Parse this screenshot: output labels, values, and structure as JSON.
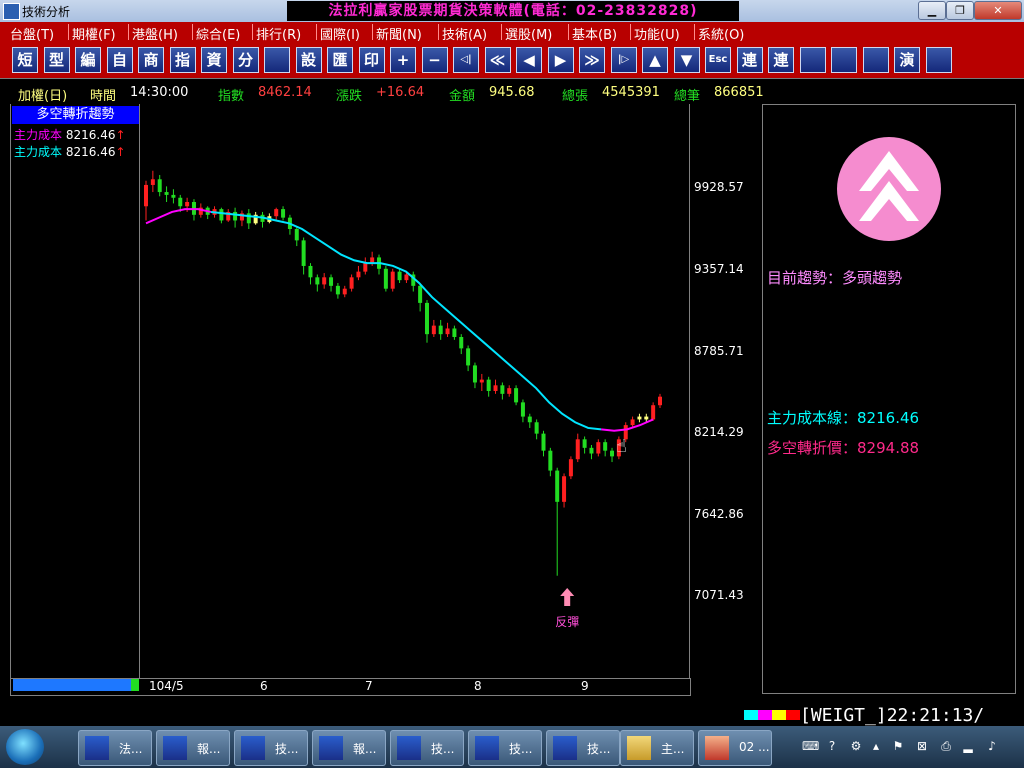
{
  "window": {
    "title": "技術分析",
    "banner": "法拉利贏家股票期貨決策軟體(電話：02-23832828)"
  },
  "menu": [
    {
      "label": "台盤(T)"
    },
    {
      "label": "期權(F)"
    },
    {
      "label": "港盤(H)"
    },
    {
      "label": "綜合(E)"
    },
    {
      "label": "排行(R)"
    },
    {
      "label": "國際(I)"
    },
    {
      "label": "新聞(N)"
    },
    {
      "label": "技術(A)"
    },
    {
      "label": "選股(M)"
    },
    {
      "label": "基本(B)"
    },
    {
      "label": "功能(U)"
    },
    {
      "label": "系統(O)"
    }
  ],
  "toolbar": [
    {
      "label": "短",
      "icon": "short-icon"
    },
    {
      "label": "型",
      "icon": "pattern-icon"
    },
    {
      "label": "編",
      "icon": "edit-icon"
    },
    {
      "label": "自",
      "icon": "custom-icon"
    },
    {
      "label": "商",
      "icon": "commodity-icon"
    },
    {
      "label": "指",
      "icon": "index-icon"
    },
    {
      "label": "資",
      "icon": "data-icon"
    },
    {
      "label": "分",
      "icon": "split-icon"
    },
    {
      "label": "",
      "icon": "chart-icon"
    },
    {
      "label": "設",
      "icon": "settings-icon"
    },
    {
      "label": "匯",
      "icon": "export-icon"
    },
    {
      "label": "印",
      "icon": "print-icon"
    },
    {
      "label": "+",
      "icon": "zoom-in-icon"
    },
    {
      "label": "−",
      "icon": "zoom-out-icon"
    },
    {
      "label": "◁|",
      "icon": "first-icon"
    },
    {
      "label": "≪",
      "icon": "fast-back-icon"
    },
    {
      "label": "◀",
      "icon": "back-icon"
    },
    {
      "label": "▶",
      "icon": "forward-icon"
    },
    {
      "label": "≫",
      "icon": "fast-forward-icon"
    },
    {
      "label": "|▷",
      "icon": "last-icon"
    },
    {
      "label": "▲",
      "icon": "up-icon"
    },
    {
      "label": "▼",
      "icon": "down-icon"
    },
    {
      "label": "Esc",
      "icon": "esc-icon"
    },
    {
      "label": "連",
      "icon": "link-icon"
    },
    {
      "label": "連",
      "icon": "link2-icon"
    },
    {
      "label": "",
      "icon": "window-icon"
    },
    {
      "label": "",
      "icon": "lock-icon"
    },
    {
      "label": "",
      "icon": "tools-icon"
    },
    {
      "label": "演",
      "icon": "demo-icon"
    },
    {
      "label": "",
      "icon": "note-icon"
    }
  ],
  "info": {
    "name": "加權(日)",
    "time_label": "時間",
    "time": "14:30:00",
    "index_label": "指數",
    "index": "8462.14",
    "change_label": "漲跌",
    "change": "+16.64",
    "amount_label": "金額",
    "amount": "945.68",
    "volume_label": "總張",
    "volume": "4545391",
    "trades_label": "總筆",
    "trades": "866851"
  },
  "left_panel": {
    "header": "多空轉折趨勢",
    "legend": [
      {
        "label": "主力成本",
        "value": "8216.46",
        "color": "#ff00ff"
      },
      {
        "label": "主力成本",
        "value": "8216.46",
        "color": "#00ffff"
      }
    ]
  },
  "chart_data": {
    "type": "candlestick",
    "y_ticks": [
      "9928.57",
      "9357.14",
      "8785.71",
      "8214.29",
      "7642.86",
      "7071.43"
    ],
    "ylim": [
      7071.43,
      9928.57
    ],
    "x_ticks": [
      "104/5",
      "6",
      "7",
      "8",
      "9"
    ],
    "annotation": "反彈",
    "colors": {
      "up": "#ff2020",
      "down": "#22dd22",
      "neutral": "#ffff80",
      "cost_line": "#00e5ff",
      "cost_line_early": "#ff00ff"
    },
    "candles": [
      [
        9800,
        9950,
        9700,
        9980
      ],
      [
        9950,
        9990,
        9900,
        10050
      ],
      [
        9990,
        9900,
        9870,
        10020
      ],
      [
        9900,
        9880,
        9830,
        9940
      ],
      [
        9880,
        9860,
        9820,
        9920
      ],
      [
        9860,
        9800,
        9760,
        9880
      ],
      [
        9800,
        9830,
        9760,
        9860
      ],
      [
        9830,
        9740,
        9700,
        9850
      ],
      [
        9740,
        9790,
        9720,
        9820
      ],
      [
        9790,
        9740,
        9710,
        9800
      ],
      [
        9740,
        9780,
        9720,
        9800
      ],
      [
        9780,
        9700,
        9680,
        9790
      ],
      [
        9700,
        9760,
        9690,
        9780
      ],
      [
        9760,
        9700,
        9650,
        9790
      ],
      [
        9700,
        9750,
        9660,
        9770
      ],
      [
        9750,
        9680,
        9640,
        9780
      ],
      [
        9680,
        9740,
        9670,
        9760
      ],
      [
        9740,
        9690,
        9650,
        9760
      ],
      [
        9690,
        9730,
        9680,
        9750
      ],
      [
        9730,
        9780,
        9700,
        9790
      ],
      [
        9780,
        9720,
        9700,
        9800
      ],
      [
        9720,
        9640,
        9600,
        9740
      ],
      [
        9640,
        9560,
        9520,
        9660
      ],
      [
        9560,
        9380,
        9320,
        9580
      ],
      [
        9380,
        9300,
        9250,
        9400
      ],
      [
        9300,
        9250,
        9200,
        9320
      ],
      [
        9250,
        9300,
        9220,
        9330
      ],
      [
        9300,
        9240,
        9200,
        9320
      ],
      [
        9240,
        9180,
        9150,
        9260
      ],
      [
        9180,
        9220,
        9160,
        9240
      ],
      [
        9220,
        9300,
        9200,
        9320
      ],
      [
        9300,
        9340,
        9280,
        9380
      ],
      [
        9340,
        9400,
        9320,
        9440
      ],
      [
        9400,
        9440,
        9380,
        9480
      ],
      [
        9440,
        9360,
        9320,
        9460
      ],
      [
        9360,
        9220,
        9200,
        9380
      ],
      [
        9220,
        9340,
        9200,
        9360
      ],
      [
        9340,
        9280,
        9260,
        9360
      ],
      [
        9280,
        9320,
        9260,
        9340
      ],
      [
        9320,
        9240,
        9200,
        9340
      ],
      [
        9240,
        9120,
        9060,
        9260
      ],
      [
        9120,
        8900,
        8840,
        9140
      ],
      [
        8900,
        8960,
        8880,
        9000
      ],
      [
        8960,
        8900,
        8860,
        9000
      ],
      [
        8900,
        8940,
        8880,
        8980
      ],
      [
        8940,
        8880,
        8860,
        8960
      ],
      [
        8880,
        8800,
        8760,
        8900
      ],
      [
        8800,
        8680,
        8640,
        8820
      ],
      [
        8680,
        8560,
        8520,
        8700
      ],
      [
        8560,
        8580,
        8500,
        8620
      ],
      [
        8580,
        8500,
        8460,
        8600
      ],
      [
        8500,
        8540,
        8480,
        8580
      ],
      [
        8540,
        8480,
        8440,
        8560
      ],
      [
        8480,
        8520,
        8460,
        8540
      ],
      [
        8520,
        8420,
        8400,
        8540
      ],
      [
        8420,
        8320,
        8280,
        8440
      ],
      [
        8320,
        8280,
        8240,
        8340
      ],
      [
        8280,
        8200,
        8160,
        8300
      ],
      [
        8200,
        8080,
        8040,
        8220
      ],
      [
        8080,
        7940,
        7900,
        8100
      ],
      [
        7940,
        7720,
        7200,
        7960
      ],
      [
        7720,
        7900,
        7680,
        7920
      ],
      [
        7900,
        8020,
        7880,
        8040
      ],
      [
        8020,
        8160,
        8000,
        8200
      ],
      [
        8160,
        8100,
        8060,
        8180
      ],
      [
        8100,
        8060,
        8020,
        8120
      ],
      [
        8060,
        8140,
        8040,
        8160
      ],
      [
        8140,
        8080,
        8040,
        8160
      ],
      [
        8080,
        8040,
        8000,
        8100
      ],
      [
        8040,
        8160,
        8020,
        8180
      ],
      [
        8160,
        8260,
        8140,
        8280
      ],
      [
        8260,
        8300,
        8240,
        8320
      ],
      [
        8300,
        8320,
        8280,
        8340
      ],
      [
        8320,
        8300,
        8280,
        8340
      ],
      [
        8300,
        8400,
        8290,
        8420
      ],
      [
        8400,
        8460,
        8380,
        8480
      ]
    ],
    "cost_line": [
      9680,
      9720,
      9760,
      9780,
      9780,
      9760,
      9750,
      9740,
      9730,
      9720,
      9700,
      9680,
      9640,
      9580,
      9520,
      9460,
      9420,
      9400,
      9400,
      9380,
      9340,
      9260,
      9160,
      9080,
      9000,
      8920,
      8840,
      8760,
      8680,
      8600,
      8520,
      8420,
      8340,
      8280,
      8240,
      8230,
      8220,
      8230,
      8260,
      8300
    ]
  },
  "right_panel": {
    "trend_label": "目前趨勢：",
    "trend_value": "多頭趨勢",
    "cost_label": "主力成本線：",
    "cost_value": "8216.46",
    "turn_label": "多空轉折價：",
    "turn_value": "8294.88"
  },
  "status": {
    "text": "[WEIGT_]22:21:13/"
  },
  "taskbar": [
    {
      "label": "法..."
    },
    {
      "label": "報..."
    },
    {
      "label": "技..."
    },
    {
      "label": "報..."
    },
    {
      "label": "技..."
    },
    {
      "label": "技..."
    },
    {
      "label": "技..."
    },
    {
      "label": "主..."
    },
    {
      "label": "02 ..."
    }
  ]
}
